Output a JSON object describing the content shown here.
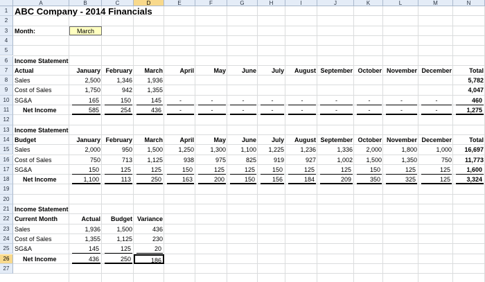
{
  "sheet": {
    "columns": [
      "A",
      "B",
      "C",
      "D",
      "E",
      "F",
      "G",
      "H",
      "I",
      "J",
      "K",
      "L",
      "M",
      "N"
    ],
    "rows": [
      "1",
      "2",
      "3",
      "4",
      "5",
      "6",
      "7",
      "8",
      "9",
      "10",
      "11",
      "12",
      "13",
      "14",
      "15",
      "16",
      "17",
      "18",
      "19",
      "20",
      "21",
      "22",
      "23",
      "24",
      "25",
      "26",
      "27"
    ],
    "selected_column": "D",
    "selected_row": "26"
  },
  "title": "ABC Company - 2014 Financials",
  "month_label": "Month:",
  "month_value": "March",
  "months": [
    "January",
    "February",
    "March",
    "April",
    "May",
    "June",
    "July",
    "August",
    "September",
    "October",
    "November",
    "December",
    "Total"
  ],
  "actual": {
    "section": "Income Statement",
    "label": "Actual",
    "rows": [
      {
        "label": "Sales",
        "values": [
          "2,500",
          "1,346",
          "1,936",
          "",
          "",
          "",
          "",
          "",
          "",
          "",
          "",
          "",
          "5,782"
        ]
      },
      {
        "label": "Cost of Sales",
        "values": [
          "1,750",
          "942",
          "1,355",
          "",
          "",
          "",
          "",
          "",
          "",
          "",
          "",
          "",
          "4,047"
        ]
      },
      {
        "label": "SG&A",
        "values": [
          "165",
          "150",
          "145",
          "-",
          "-",
          "-",
          "-",
          "-",
          "-",
          "-",
          "-",
          "-",
          "460"
        ]
      },
      {
        "label": "Net Income",
        "values": [
          "585",
          "254",
          "436",
          "-",
          "-",
          "-",
          "-",
          "-",
          "-",
          "-",
          "-",
          "-",
          "1,275"
        ]
      }
    ]
  },
  "budget": {
    "section": "Income Statement",
    "label": "Budget",
    "rows": [
      {
        "label": "Sales",
        "values": [
          "2,000",
          "950",
          "1,500",
          "1,250",
          "1,300",
          "1,100",
          "1,225",
          "1,236",
          "1,336",
          "2,000",
          "1,800",
          "1,000",
          "16,697"
        ]
      },
      {
        "label": "Cost of Sales",
        "values": [
          "750",
          "713",
          "1,125",
          "938",
          "975",
          "825",
          "919",
          "927",
          "1,002",
          "1,500",
          "1,350",
          "750",
          "11,773"
        ]
      },
      {
        "label": "SG&A",
        "values": [
          "150",
          "125",
          "125",
          "150",
          "125",
          "125",
          "150",
          "125",
          "125",
          "150",
          "125",
          "125",
          "1,600"
        ]
      },
      {
        "label": "Net Income",
        "values": [
          "1,100",
          "113",
          "250",
          "163",
          "200",
          "150",
          "156",
          "184",
          "209",
          "350",
          "325",
          "125",
          "3,324"
        ]
      }
    ]
  },
  "current": {
    "section": "Income Statement",
    "label": "Current Month",
    "headers": [
      "Actual",
      "Budget",
      "Variance"
    ],
    "rows": [
      {
        "label": "Sales",
        "values": [
          "1,936",
          "1,500",
          "436"
        ]
      },
      {
        "label": "Cost of Sales",
        "values": [
          "1,355",
          "1,125",
          "230"
        ]
      },
      {
        "label": "SG&A",
        "values": [
          "145",
          "125",
          "20"
        ]
      },
      {
        "label": "Net Income",
        "values": [
          "436",
          "250",
          "186"
        ]
      }
    ]
  }
}
